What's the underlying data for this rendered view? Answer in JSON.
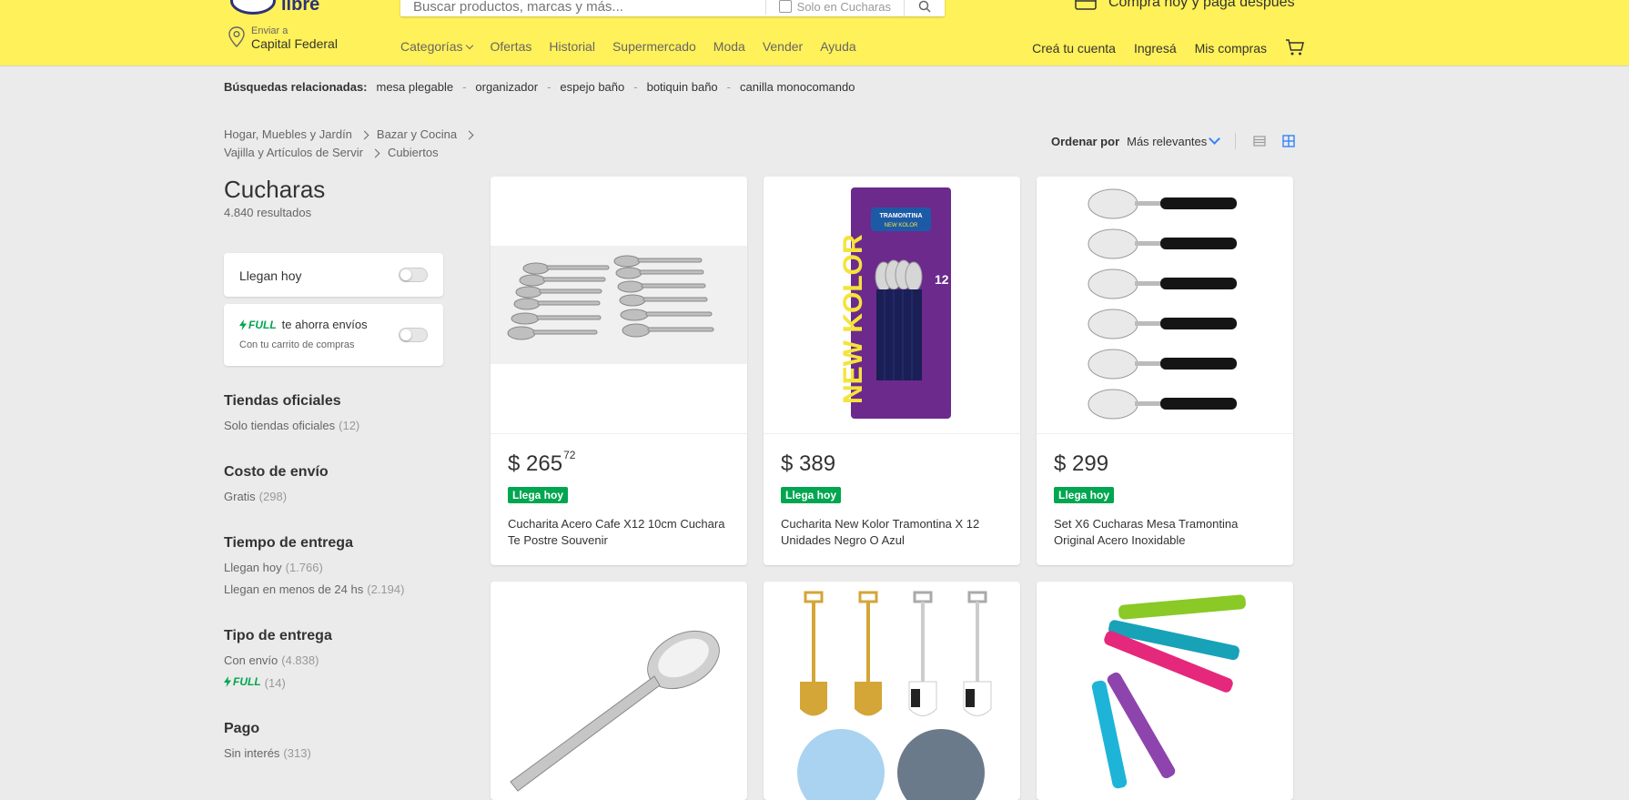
{
  "header": {
    "logo_text": "libre",
    "search_placeholder": "Buscar productos, marcas y más...",
    "search_scope": "Solo en Cucharas",
    "promo": "Comprá hoy y pagá después",
    "location_line1": "Enviar a",
    "location_line2": "Capital Federal",
    "nav": [
      "Categorías",
      "Ofertas",
      "Historial",
      "Supermercado",
      "Moda",
      "Vender",
      "Ayuda"
    ],
    "user_nav": [
      "Creá tu cuenta",
      "Ingresá",
      "Mis compras"
    ]
  },
  "related": {
    "label": "Búsquedas relacionadas:",
    "items": [
      "mesa plegable",
      "organizador",
      "espejo baño",
      "botiquin baño",
      "canilla monocomando"
    ]
  },
  "breadcrumb": {
    "row1": [
      "Hogar, Muebles y Jardín",
      "Bazar y Cocina"
    ],
    "row2": [
      "Vajilla y Artículos de Servir",
      "Cubiertos"
    ]
  },
  "sort": {
    "label": "Ordenar por",
    "value": "Más relevantes"
  },
  "page": {
    "title": "Cucharas",
    "count": "4.840 resultados"
  },
  "filters": {
    "llegan_hoy": "Llegan hoy",
    "full_label": "FULL",
    "full_text": "te ahorra envíos",
    "full_sub": "Con tu carrito de compras",
    "sections": [
      {
        "title": "Tiendas oficiales",
        "options": [
          {
            "label": "Solo tiendas oficiales",
            "count": "(12)"
          }
        ]
      },
      {
        "title": "Costo de envío",
        "options": [
          {
            "label": "Gratis",
            "count": "(298)"
          }
        ]
      },
      {
        "title": "Tiempo de entrega",
        "options": [
          {
            "label": "Llegan hoy",
            "count": "(1.766)"
          },
          {
            "label": "Llegan en menos de 24 hs",
            "count": "(2.194)"
          }
        ]
      },
      {
        "title": "Tipo de entrega",
        "options": [
          {
            "label": "Con envío",
            "count": "(4.838)"
          },
          {
            "label": "FULL",
            "count": "(14)"
          }
        ]
      },
      {
        "title": "Pago",
        "options": [
          {
            "label": "Sin interés",
            "count": "(313)"
          }
        ]
      }
    ]
  },
  "products": [
    {
      "price": "$ 265",
      "cents": "72",
      "badge": "Llega hoy",
      "name": "Cucharita Acero Cafe X12 10cm Cuchara Te Postre Souvenir"
    },
    {
      "price": "$ 389",
      "cents": "",
      "badge": "Llega hoy",
      "name": "Cucharita New Kolor Tramontina X 12 Unidades Negro O Azul"
    },
    {
      "price": "$ 299",
      "cents": "",
      "badge": "Llega hoy",
      "name": "Set X6 Cucharas Mesa Tramontina Original Acero Inoxidable"
    },
    {
      "price": "",
      "cents": "",
      "badge": "",
      "name": ""
    },
    {
      "price": "",
      "cents": "",
      "badge": "",
      "name": ""
    },
    {
      "price": "",
      "cents": "",
      "badge": "",
      "name": ""
    }
  ],
  "packaging": {
    "brand": "TRAMONTINA",
    "line": "NEW KOLOR",
    "qty": "12",
    "tagline": "NEW KOLOR"
  },
  "colors": {
    "header_bg": "#fff159",
    "accent": "#3483fa",
    "green": "#00a650",
    "page_bg": "#ebebeb"
  }
}
